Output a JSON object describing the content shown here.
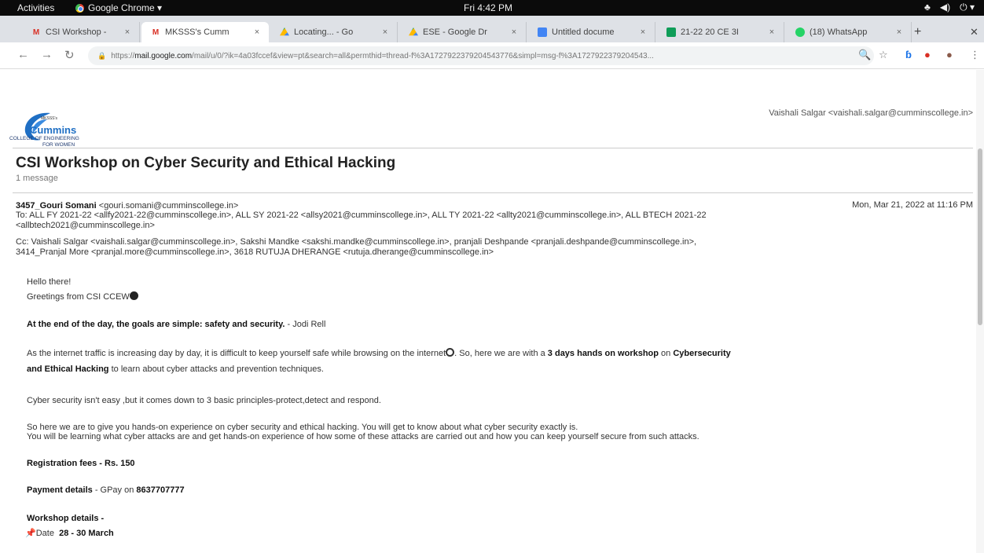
{
  "topbar": {
    "activities": "Activities",
    "app": "Google Chrome ▾",
    "clock": "Fri 4:42 PM",
    "tray": [
      "♣",
      "◀)",
      "⏻ ▾"
    ]
  },
  "tabs": [
    {
      "title": "CSI Workshop -",
      "icon": "gmail-icon"
    },
    {
      "title": "MKSSS's Cumm",
      "icon": "gmail-icon"
    },
    {
      "title": "Locating... - Go",
      "icon": "drive-icon"
    },
    {
      "title": "ESE - Google Dr",
      "icon": "drive-icon"
    },
    {
      "title": "Untitled docume",
      "icon": "docs-icon"
    },
    {
      "title": "21-22 20 CE 3I",
      "icon": "sheets-icon"
    },
    {
      "title": "(18) WhatsApp",
      "icon": "whatsapp-icon"
    }
  ],
  "address": {
    "scheme": "https://",
    "host": "mail.google.com",
    "path": "/mail/u/0/?ik=4a03fccef&view=pt&search=all&permthid=thread-f%3A1727922379204543776&simpl=msg-f%3A1727922379204543..."
  },
  "email": {
    "account": "Vaishali Salgar <vaishali.salgar@cumminscollege.in>",
    "logo": {
      "small": "MKSSS's",
      "brand": "Cummins",
      "line2": "COLLEGE OF ENGINEERING",
      "line3": "FOR WOMEN"
    },
    "subject": "CSI Workshop on Cyber Security and Ethical Hacking",
    "count": "1 message",
    "from_name": "3457_Gouri Somani",
    "from_email": " <gouri.somani@cumminscollege.in>",
    "date": "Mon, Mar 21, 2022 at 11:16 PM",
    "to_line1": "To: ALL FY 2021-22 <allfy2021-22@cumminscollege.in>, ALL SY 2021-22 <allsy2021@cumminscollege.in>, ALL TY 2021-22 <allty2021@cumminscollege.in>, ALL BTECH 2021-22",
    "to_line2": "<allbtech2021@cumminscollege.in>",
    "cc_line1": "Cc: Vaishali Salgar <vaishali.salgar@cumminscollege.in>, Sakshi Mandke <sakshi.mandke@cumminscollege.in>, pranjali Deshpande <pranjali.deshpande@cumminscollege.in>,",
    "cc_line2": "3414_Pranjal More <pranjal.more@cumminscollege.in>, 3618 RUTUJA DHERANGE <rutuja.dherange@cumminscollege.in>",
    "hello": "Hello there!",
    "greetings": "Greetings from CSI CCEW",
    "quote_bold": "At the end of the day, the goals are simple: safety and security.",
    "quote_author": " - Jodi Rell",
    "para1_a": "As the internet traffic is increasing day by day, it is difficult to keep yourself safe while browsing on the internet",
    "para1_b": ". So, here we are with a ",
    "para1_bold1": "3 days hands on workshop",
    "para1_c": " on ",
    "para1_bold2": "Cybersecurity",
    "para1_bold3": "and Ethical Hacking",
    "para1_d": " to learn about cyber attacks and prevention techniques.",
    "para2": "Cyber security isn't easy ,but it comes down to 3 basic principles-protect,detect and respond.",
    "para3_line1": "So here we are to give you hands-on experience on cyber security and ethical hacking. You will get to know about what cyber security exactly is.",
    "para3_line2": "You will be learning what cyber attacks are and get hands-on experience of how some of these attacks are carried out and how you can keep yourself secure from such attacks.",
    "reg_label": "Registration fees - Rs. 150",
    "pay_label": "Payment details",
    "pay_text": " - GPay on ",
    "pay_number": "8637707777",
    "workshop_label": "Workshop details -",
    "date_label": "Date",
    "date_value": "28 - 30 March"
  }
}
